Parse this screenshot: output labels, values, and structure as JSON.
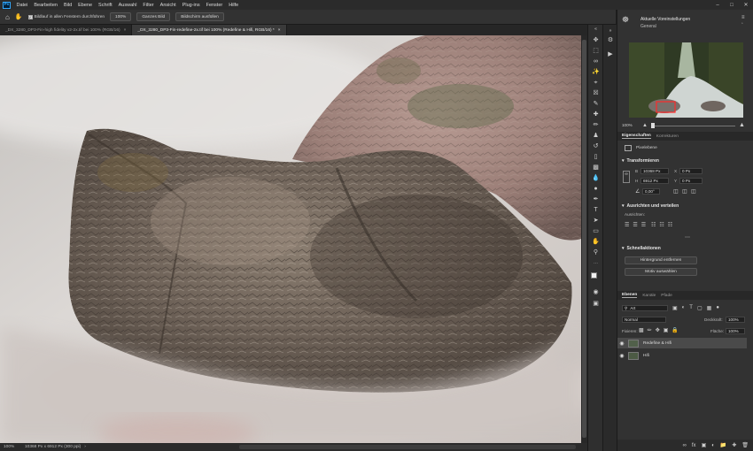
{
  "app": {
    "logo": "Ps",
    "menu": [
      "Datei",
      "Bearbeiten",
      "Bild",
      "Ebene",
      "Schrift",
      "Auswahl",
      "Filter",
      "Ansicht",
      "Plug-ins",
      "Fenster",
      "Hilfe"
    ]
  },
  "options_bar": {
    "scroll_all_label": "Bildlauf in allen Fenstern durchführen",
    "zoom_button": "100%",
    "fit_button": "Ganzes Bild",
    "fill_button": "Bildschirm ausfüllen"
  },
  "tabs": [
    {
      "label": "_DX_3280_DP3-Fin-high fidelity v2-2x.tif bei 100% (RGB/16)",
      "active": false
    },
    {
      "label": "_DX_3280_DP3-Fin-redefine-2x.tif bei 100% (Redefine & Hifi, RGB/16) *",
      "active": true
    }
  ],
  "status_bar": {
    "zoom": "100%",
    "doc_info": "10368 Px x 6912 Px (300 ppi)"
  },
  "learn_panel": {
    "title": "Aktuelle Voreinstellungen",
    "subtitle": "General"
  },
  "navigator": {
    "zoom": "100%"
  },
  "properties_panel": {
    "tabs": [
      "Eigenschaften",
      "Korrekturen"
    ],
    "layer_type": "Pixelebene",
    "transform_title": "Transformieren",
    "width_label": "B",
    "width_value": "10368 Px",
    "height_label": "H",
    "height_value": "6912 Px",
    "x_label": "X",
    "x_value": "0 Px",
    "y_label": "Y",
    "y_value": "0 Px",
    "angle_value": "0,00°",
    "align_title": "Ausrichten und verteilen",
    "align_label": "Ausrichten:",
    "quick_title": "Schnellaktionen",
    "quick_remove_bg": "Hintergrund entfernen",
    "quick_select_subject": "Motiv auswählen"
  },
  "layers_panel": {
    "tabs": [
      "Ebenen",
      "Kanäle",
      "Pfade"
    ],
    "search_kind": "Art",
    "blend_mode": "Normal",
    "opacity_label": "Deckkraft:",
    "opacity_value": "100%",
    "lock_label": "Fixieren:",
    "fill_label": "Fläche:",
    "fill_value": "100%",
    "layers": [
      {
        "name": "Redefine & Hifi",
        "selected": true
      },
      {
        "name": "Hifi",
        "selected": false
      }
    ]
  }
}
